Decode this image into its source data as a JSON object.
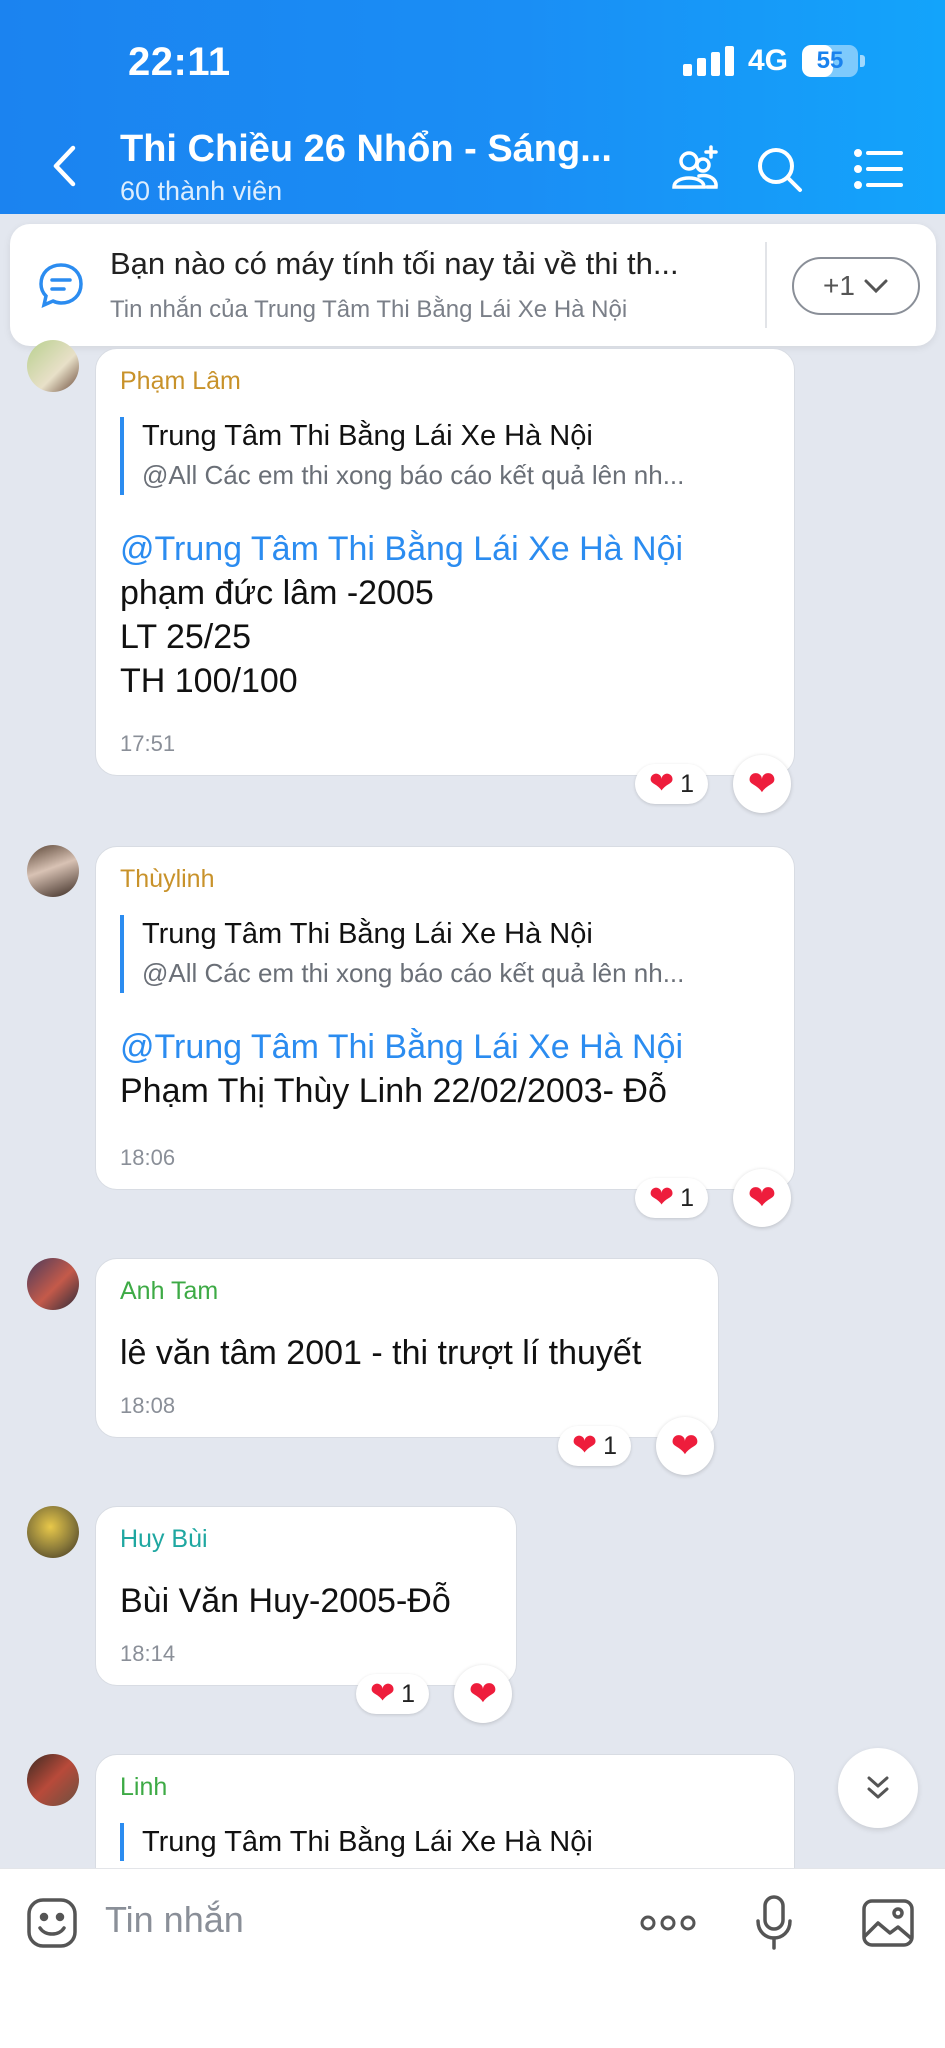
{
  "status": {
    "time": "22:11",
    "network": "4G",
    "battery": "55",
    "battery_level": 0.55
  },
  "header": {
    "title": "Thi Chiều 26 Nhổn - Sáng...",
    "subtitle": "60 thành viên"
  },
  "pinned": {
    "text": "Bạn nào có máy tính tối nay tải về thi th...",
    "source": "Tin nhắn của Trung Tâm Thi Bằng Lái Xe Hà Nội",
    "more_label": "+1"
  },
  "messages": [
    {
      "sender": "Phạm Lâm",
      "sender_color": "#c8922a",
      "quote_name": "Trung Tâm Thi Bằng Lái Xe Hà Nội",
      "quote_text": "@All Các em thi xong báo cáo kết quả lên nh...",
      "mention": "@Trung Tâm Thi Bằng Lái Xe Hà Nội",
      "lines": [
        "phạm đức lâm -2005",
        "LT 25/25",
        "TH 100/100"
      ],
      "time": "17:51",
      "reaction_count": "1"
    },
    {
      "sender": "Thùylinh",
      "sender_color": "#c8922a",
      "quote_name": "Trung Tâm Thi Bằng Lái Xe Hà Nội",
      "quote_text": "@All Các em thi xong báo cáo kết quả lên nh...",
      "mention": "@Trung Tâm Thi Bằng Lái Xe Hà Nội",
      "lines": [
        "Phạm Thị Thùy Linh 22/02/2003- Đỗ"
      ],
      "time": "18:06",
      "reaction_count": "1"
    },
    {
      "sender": "Anh Tam",
      "sender_color": "#3daa45",
      "lines": [
        "lê văn tâm 2001 - thi trượt lí thuyết"
      ],
      "time": "18:08",
      "reaction_count": "1"
    },
    {
      "sender": "Huy Bùi",
      "sender_color": "#1fa7a1",
      "lines": [
        "Bùi Văn Huy-2005-Đỗ"
      ],
      "time": "18:14",
      "reaction_count": "1"
    },
    {
      "sender": "Linh",
      "sender_color": "#3daa45",
      "quote_name": "Trung Tâm Thi Bằng Lái Xe Hà Nội"
    }
  ],
  "input": {
    "placeholder": "Tin nhắn"
  },
  "colors": {
    "header_blue": "#1a8ef5",
    "accent": "#2b8cf0",
    "heart": "#ee1d3c"
  },
  "icons": [
    "back-arrow-icon",
    "add-member-icon",
    "search-icon",
    "menu-icon",
    "pinned-message-icon",
    "chevron-down-icon",
    "heart-icon",
    "double-chevron-down-icon",
    "emoji-icon",
    "more-dots-icon",
    "microphone-icon",
    "image-icon"
  ]
}
